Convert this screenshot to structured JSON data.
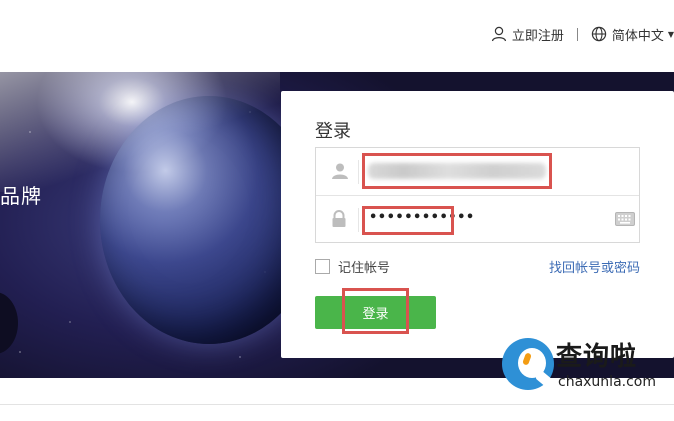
{
  "header": {
    "register_label": "立即注册",
    "separator": "|",
    "language_label": "简体中文",
    "caret": "▼"
  },
  "banner": {
    "partial_text": "品牌"
  },
  "login": {
    "title": "登录",
    "account_value": "",
    "password_value": "••••••••••••",
    "remember_label": "记住帐号",
    "forgot_label": "找回帐号或密码",
    "submit_label": "登录"
  },
  "watermark": {
    "title": "查询啦",
    "url": "chaxunla.com"
  },
  "colors": {
    "accent_green": "#4ab54a",
    "link_blue": "#3d6cb5",
    "highlight_red": "#d9534f"
  },
  "icons": [
    "user-icon",
    "globe-icon",
    "lock-icon",
    "keyboard-icon",
    "chevron-down-icon"
  ]
}
